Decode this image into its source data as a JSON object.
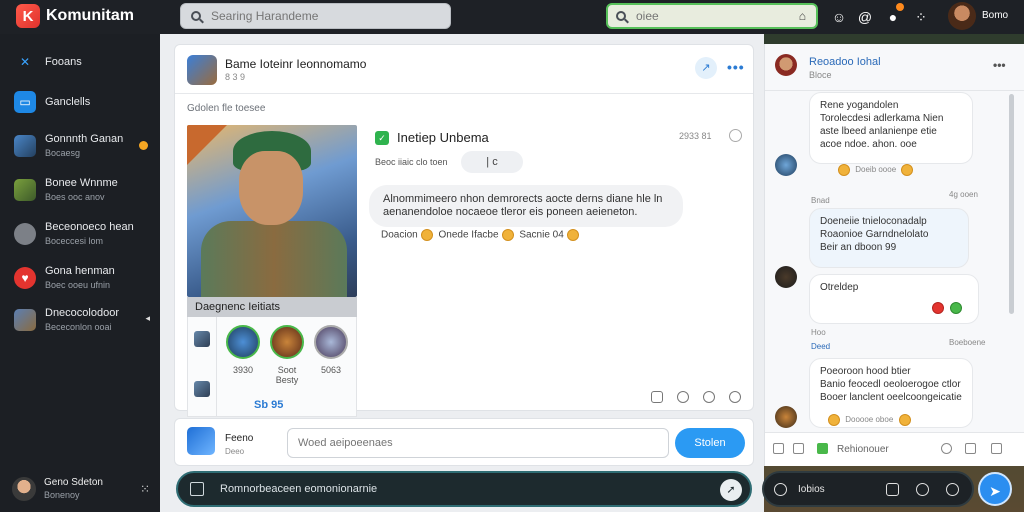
{
  "app": {
    "title": "Komunitam",
    "logo_letter": "K"
  },
  "topbar": {
    "search_placeholder": "Searing Harandeme",
    "search2_placeholder": "oiee",
    "user_name": "Bomo"
  },
  "sidebar": {
    "items": [
      {
        "label": "Fooans",
        "sub": ""
      },
      {
        "label": "Ganclells",
        "sub": ""
      },
      {
        "label": "Gonnnth Ganan",
        "sub": "Bocaesg"
      },
      {
        "label": "Bonee Wnnme",
        "sub": "Boes ooc anov"
      },
      {
        "label": "Beceonoeco hean",
        "sub": "Boceccesi lom"
      },
      {
        "label": "Gona henman",
        "sub": "Boec ooeu ufnin"
      },
      {
        "label": "Dnecocolodoor",
        "sub": "Bececonlon ooai"
      }
    ],
    "user": {
      "name": "Geno Sdeton",
      "status": "Bonenoy"
    }
  },
  "post": {
    "author": "Bame Ioteinr Ieonnomamo",
    "time": "8 3 9",
    "section": "Gdolen fle toesee",
    "hero_caption": "Daegnenc Ieitiats",
    "gallery": {
      "captions": [
        "3930",
        "Soot Besty",
        "5063"
      ],
      "price": "Sb 95"
    },
    "headline": "Inetiep Unbema",
    "headline_meta": "2933  81",
    "info": "Beoc iiaic clo toen",
    "chip": "| c",
    "comment": "Alnommimeero nhon demrorects aocte derns diane hle ln aenanendoloe nocaeoe tleror eis poneen aeieneton.",
    "reactions": [
      "Doacion",
      "Onede Ifacbe",
      "Sacnie",
      "04"
    ]
  },
  "composer": {
    "name": "Feeno",
    "sub": "Deeo",
    "placeholder": "Woed aeipoeenaes",
    "send_label": "Stolen"
  },
  "bottom_bar": {
    "text": "Romnorbeaceen eomonionarnie"
  },
  "chat": {
    "title": "Reoadoo Iohal",
    "sub": "Bloce",
    "messages": [
      {
        "who": "Rene",
        "text": "Rene yogandolen\nTorolecdesi adlerkama Nien\naste lbeed anlanienpe etie\nacoe ndoe. ahon. ooe",
        "reactions": "Doeib oooe"
      },
      {
        "meta_left": "Bnad",
        "meta_right": "4g ooen"
      },
      {
        "text": "Doeneiie tnieloconadalp\nRoaonioe Garndnelolato\nBeir an dboon 99",
        "reactions": ""
      },
      {
        "text": "Otreldep",
        "reactions": ""
      },
      {
        "meta_left": "Hoo",
        "meta_right": "Boeboene"
      },
      {
        "meta_left": "Deed",
        "meta_right": ""
      },
      {
        "text": "Poeoroon hood btier\nBanio feocedl oeoloerogoe ctlor\nBooer lanclent oeelcoongeicatie",
        "reactions": "Dooooe oboe"
      }
    ],
    "input_text": "Rehionouer",
    "bottom_text": "Iobios"
  }
}
